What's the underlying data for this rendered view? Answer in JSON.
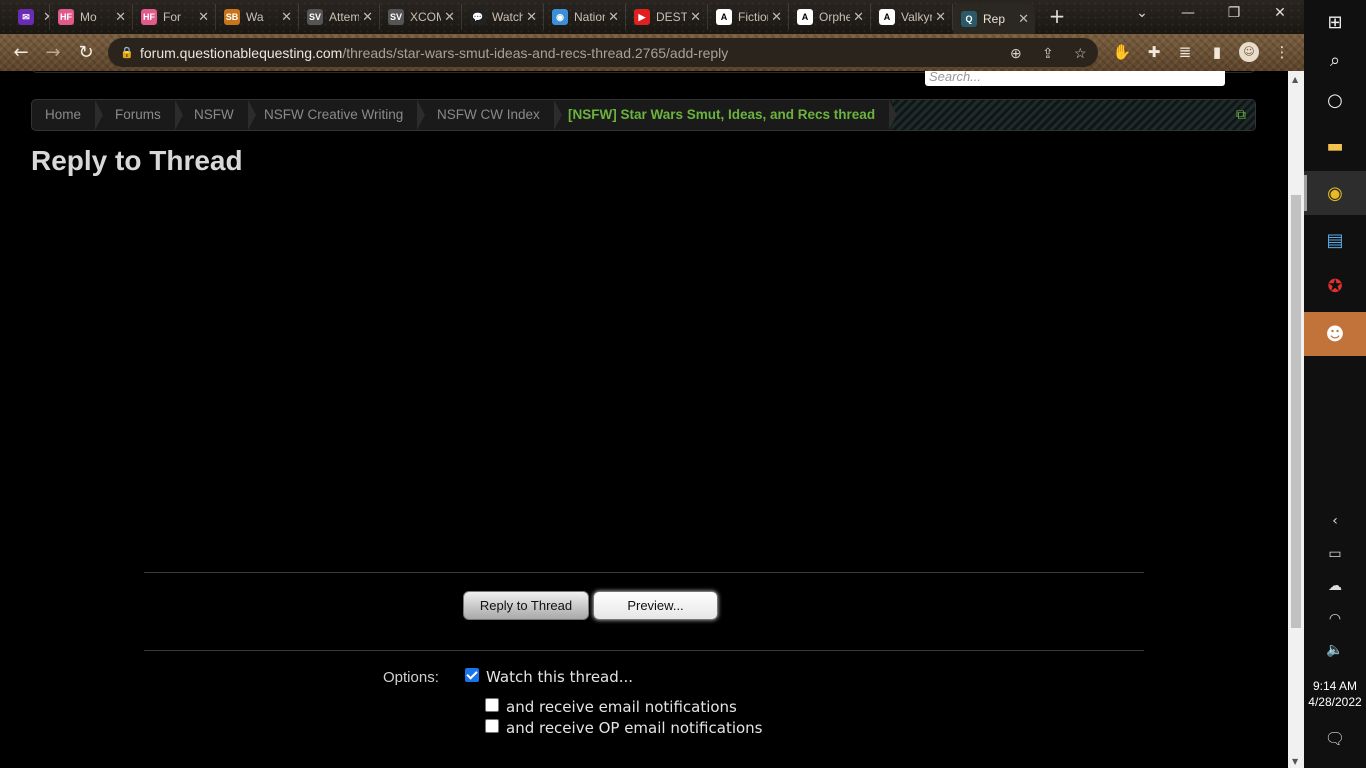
{
  "tabs": [
    {
      "favicon_color": "#6a2bb5",
      "favicon_glyph": "✉",
      "title": ""
    },
    {
      "favicon_color": "#e05a8c",
      "favicon_glyph": "HF",
      "title": "Mo"
    },
    {
      "favicon_color": "#e05a8c",
      "favicon_glyph": "HF",
      "title": "For"
    },
    {
      "favicon_color": "#c7751d",
      "favicon_glyph": "SB",
      "title": "Wa"
    },
    {
      "favicon_color": "#555555",
      "favicon_glyph": "SV",
      "title": "Attemp"
    },
    {
      "favicon_color": "#555555",
      "favicon_glyph": "SV",
      "title": "XCOM:"
    },
    {
      "favicon_color": "#222222",
      "favicon_glyph": "💬",
      "title": "Watche"
    },
    {
      "favicon_color": "#3a8fd8",
      "favicon_glyph": "◉",
      "title": "NationS"
    },
    {
      "favicon_color": "#e02020",
      "favicon_glyph": "▶",
      "title": "DESTIN"
    },
    {
      "favicon_color": "#ffffff",
      "favicon_glyph": "A",
      "title": "Fiction."
    },
    {
      "favicon_color": "#ffffff",
      "favicon_glyph": "A",
      "title": "Orpheu"
    },
    {
      "favicon_color": "#ffffff",
      "favicon_glyph": "A",
      "title": "Valkyrie"
    },
    {
      "favicon_color": "#2a5a6a",
      "favicon_glyph": "Q",
      "title": "Rep"
    }
  ],
  "address_bar": {
    "host": "forum.questionablequesting.com",
    "path": "/threads/star-wars-smut-ideas-and-recs-thread.2765/add-reply"
  },
  "search": {
    "placeholder": "Search..."
  },
  "breadcrumb": [
    "Home",
    "Forums",
    "NSFW",
    "NSFW Creative Writing",
    "NSFW CW Index"
  ],
  "breadcrumb_current": "[NSFW] Star Wars Smut, Ideas, and Recs thread",
  "page_title": "Reply to Thread",
  "buttons": {
    "reply": "Reply to Thread",
    "preview": "Preview..."
  },
  "options": {
    "label": "Options:",
    "watch": {
      "label": "Watch this thread...",
      "checked": true
    },
    "email": {
      "label": "and receive email notifications",
      "checked": false
    },
    "op_email": {
      "label": "and receive OP email notifications",
      "checked": false
    }
  },
  "clock": {
    "time": "9:14 AM",
    "date": "4/28/2022"
  },
  "colors": {
    "accent_green": "#6cb33e",
    "checkbox_blue": "#1a73e8",
    "taskbar_flash": "#c2733a"
  }
}
